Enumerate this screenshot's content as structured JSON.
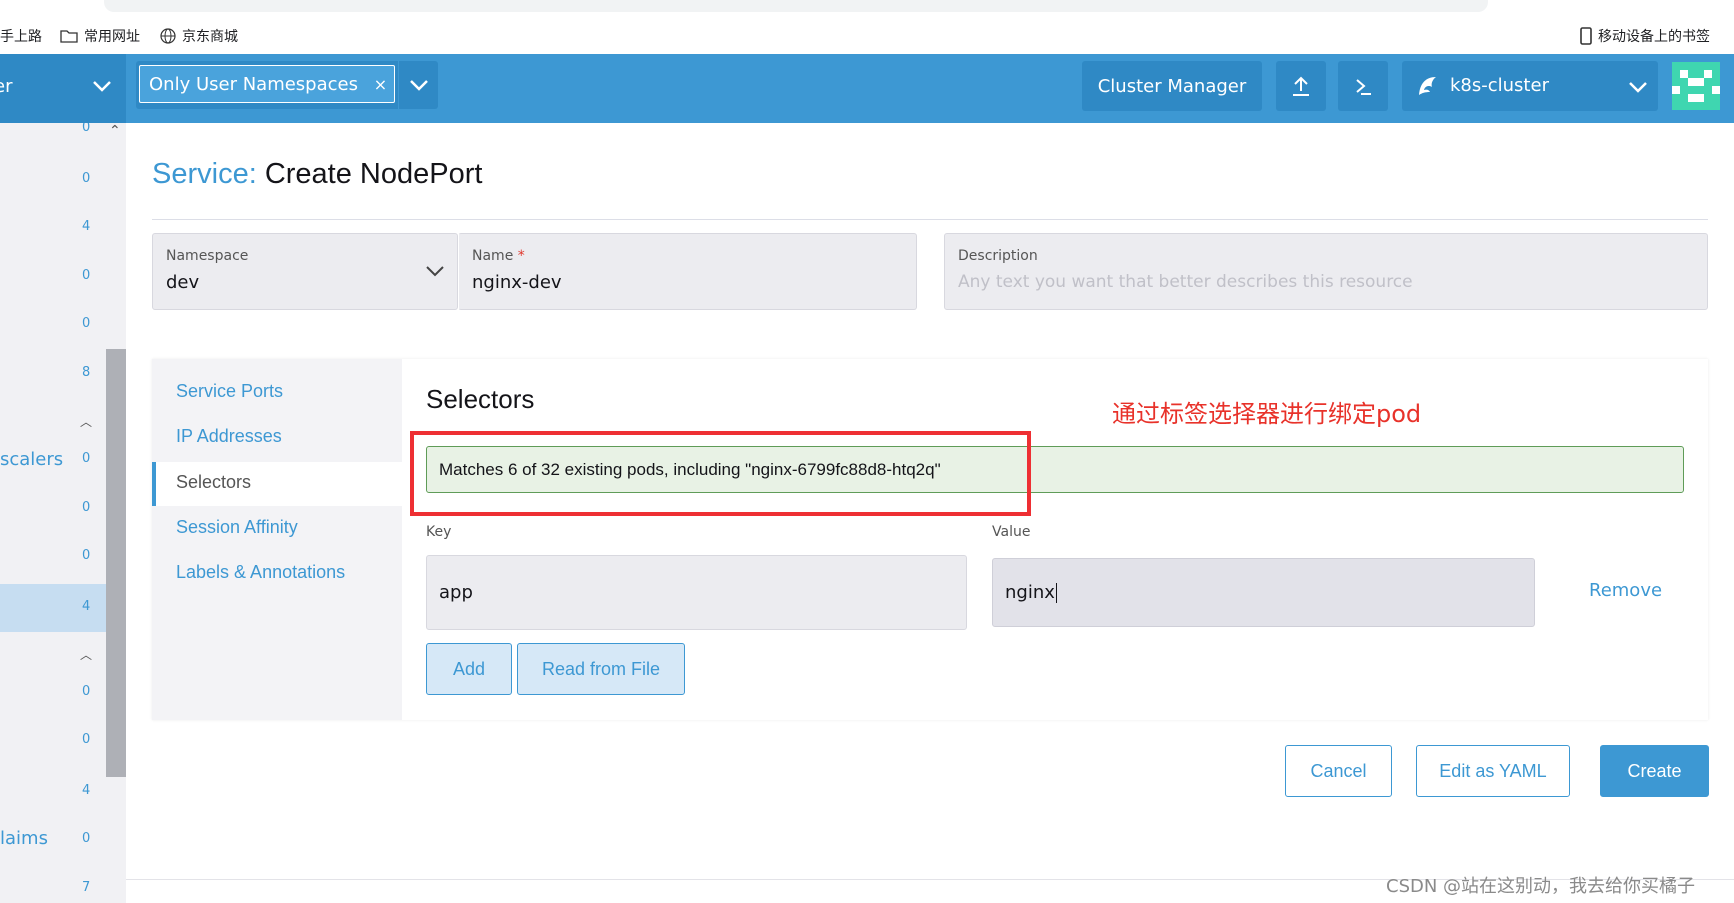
{
  "bookmarks": {
    "item1": "手上路",
    "item2": "常用网址",
    "item3": "京东商城",
    "mobile": "移动设备上的书签"
  },
  "header": {
    "left_stub": "er",
    "namespace_filter": "Only User Namespaces",
    "namespace_remove": "×",
    "cluster_manager": "Cluster Manager",
    "cluster_name": "k8s-cluster"
  },
  "sidebar": {
    "counts": [
      "0",
      "0",
      "4",
      "0",
      "0",
      "8",
      "0",
      "0",
      "0",
      "4",
      "0",
      "0",
      "4",
      "0",
      "7"
    ],
    "label_scalers": "scalers",
    "label_claims": "laims"
  },
  "page": {
    "title_prefix": "Service:",
    "title_main": "Create NodePort"
  },
  "form": {
    "namespace_label": "Namespace",
    "namespace_value": "dev",
    "name_label": "Name",
    "name_required": "*",
    "name_value": "nginx-dev",
    "description_label": "Description",
    "description_placeholder": "Any text you want that better describes this resource"
  },
  "tabs": [
    "Service Ports",
    "IP Addresses",
    "Selectors",
    "Session Affinity",
    "Labels & Annotations"
  ],
  "active_tab": "Selectors",
  "selectors": {
    "title": "Selectors",
    "annotation": "通过标签选择器进行绑定pod",
    "match_banner": "Matches 6 of 32 existing pods, including \"nginx-6799fc88d8-htq2q\"",
    "key_label": "Key",
    "value_label": "Value",
    "key_value": "app",
    "value_value": "nginx",
    "remove": "Remove",
    "add": "Add",
    "read_from_file": "Read from File"
  },
  "footer_buttons": {
    "cancel": "Cancel",
    "edit_yaml": "Edit as YAML",
    "create": "Create"
  },
  "watermark": "CSDN @站在这别动，我去给你买橘子",
  "colors": {
    "accent": "#3d98d3",
    "header": "#3d98d3",
    "annotation_red": "#ee2f33",
    "success_bg": "#e8f2e5"
  }
}
